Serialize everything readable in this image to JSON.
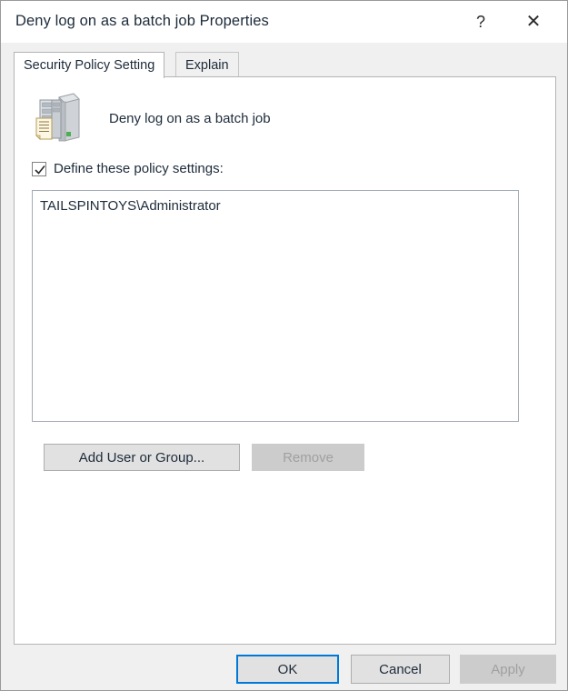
{
  "window": {
    "title": "Deny log on as a batch job Properties",
    "help_glyph": "?",
    "close_glyph": "✕",
    "border_color": "#9a9a9a",
    "titlebar_bg": "#ffffff",
    "title_color": "#1d2b3a"
  },
  "tabs": [
    {
      "label": "Security Policy Setting",
      "active": true
    },
    {
      "label": "Explain",
      "active": false
    }
  ],
  "policy": {
    "name": "Deny log on as a batch job",
    "icon": "server-policy-icon"
  },
  "define_checkbox": {
    "label": "Define these policy settings:",
    "checked": true
  },
  "principals": {
    "items": [
      "TAILSPINTOYS\\Administrator"
    ]
  },
  "list_actions": {
    "add_label": "Add User or Group...",
    "add_enabled": true,
    "remove_label": "Remove",
    "remove_enabled": false
  },
  "footer": {
    "ok_label": "OK",
    "cancel_label": "Cancel",
    "apply_label": "Apply",
    "apply_enabled": false,
    "default_button": "OK"
  },
  "colors": {
    "accent": "#0078d7",
    "dialog_bg": "#f0f0f0",
    "panel_bg": "#ffffff",
    "button_face": "#e1e1e1",
    "button_disabled": "#cccccc",
    "disabled_text": "#a0a0a0",
    "text": "#1d2b3a"
  }
}
